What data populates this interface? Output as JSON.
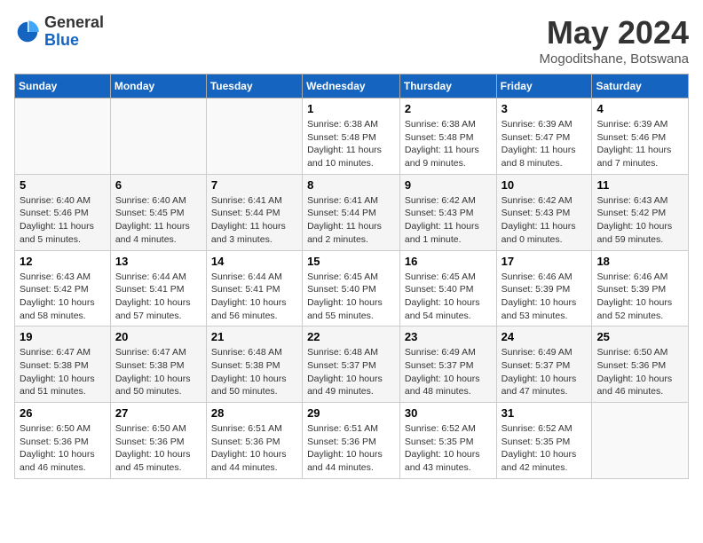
{
  "header": {
    "logo_general": "General",
    "logo_blue": "Blue",
    "month_title": "May 2024",
    "location": "Mogoditshane, Botswana"
  },
  "days_of_week": [
    "Sunday",
    "Monday",
    "Tuesday",
    "Wednesday",
    "Thursday",
    "Friday",
    "Saturday"
  ],
  "weeks": [
    [
      {
        "day": "",
        "info": ""
      },
      {
        "day": "",
        "info": ""
      },
      {
        "day": "",
        "info": ""
      },
      {
        "day": "1",
        "info": "Sunrise: 6:38 AM\nSunset: 5:48 PM\nDaylight: 11 hours and 10 minutes."
      },
      {
        "day": "2",
        "info": "Sunrise: 6:38 AM\nSunset: 5:48 PM\nDaylight: 11 hours and 9 minutes."
      },
      {
        "day": "3",
        "info": "Sunrise: 6:39 AM\nSunset: 5:47 PM\nDaylight: 11 hours and 8 minutes."
      },
      {
        "day": "4",
        "info": "Sunrise: 6:39 AM\nSunset: 5:46 PM\nDaylight: 11 hours and 7 minutes."
      }
    ],
    [
      {
        "day": "5",
        "info": "Sunrise: 6:40 AM\nSunset: 5:46 PM\nDaylight: 11 hours and 5 minutes."
      },
      {
        "day": "6",
        "info": "Sunrise: 6:40 AM\nSunset: 5:45 PM\nDaylight: 11 hours and 4 minutes."
      },
      {
        "day": "7",
        "info": "Sunrise: 6:41 AM\nSunset: 5:44 PM\nDaylight: 11 hours and 3 minutes."
      },
      {
        "day": "8",
        "info": "Sunrise: 6:41 AM\nSunset: 5:44 PM\nDaylight: 11 hours and 2 minutes."
      },
      {
        "day": "9",
        "info": "Sunrise: 6:42 AM\nSunset: 5:43 PM\nDaylight: 11 hours and 1 minute."
      },
      {
        "day": "10",
        "info": "Sunrise: 6:42 AM\nSunset: 5:43 PM\nDaylight: 11 hours and 0 minutes."
      },
      {
        "day": "11",
        "info": "Sunrise: 6:43 AM\nSunset: 5:42 PM\nDaylight: 10 hours and 59 minutes."
      }
    ],
    [
      {
        "day": "12",
        "info": "Sunrise: 6:43 AM\nSunset: 5:42 PM\nDaylight: 10 hours and 58 minutes."
      },
      {
        "day": "13",
        "info": "Sunrise: 6:44 AM\nSunset: 5:41 PM\nDaylight: 10 hours and 57 minutes."
      },
      {
        "day": "14",
        "info": "Sunrise: 6:44 AM\nSunset: 5:41 PM\nDaylight: 10 hours and 56 minutes."
      },
      {
        "day": "15",
        "info": "Sunrise: 6:45 AM\nSunset: 5:40 PM\nDaylight: 10 hours and 55 minutes."
      },
      {
        "day": "16",
        "info": "Sunrise: 6:45 AM\nSunset: 5:40 PM\nDaylight: 10 hours and 54 minutes."
      },
      {
        "day": "17",
        "info": "Sunrise: 6:46 AM\nSunset: 5:39 PM\nDaylight: 10 hours and 53 minutes."
      },
      {
        "day": "18",
        "info": "Sunrise: 6:46 AM\nSunset: 5:39 PM\nDaylight: 10 hours and 52 minutes."
      }
    ],
    [
      {
        "day": "19",
        "info": "Sunrise: 6:47 AM\nSunset: 5:38 PM\nDaylight: 10 hours and 51 minutes."
      },
      {
        "day": "20",
        "info": "Sunrise: 6:47 AM\nSunset: 5:38 PM\nDaylight: 10 hours and 50 minutes."
      },
      {
        "day": "21",
        "info": "Sunrise: 6:48 AM\nSunset: 5:38 PM\nDaylight: 10 hours and 50 minutes."
      },
      {
        "day": "22",
        "info": "Sunrise: 6:48 AM\nSunset: 5:37 PM\nDaylight: 10 hours and 49 minutes."
      },
      {
        "day": "23",
        "info": "Sunrise: 6:49 AM\nSunset: 5:37 PM\nDaylight: 10 hours and 48 minutes."
      },
      {
        "day": "24",
        "info": "Sunrise: 6:49 AM\nSunset: 5:37 PM\nDaylight: 10 hours and 47 minutes."
      },
      {
        "day": "25",
        "info": "Sunrise: 6:50 AM\nSunset: 5:36 PM\nDaylight: 10 hours and 46 minutes."
      }
    ],
    [
      {
        "day": "26",
        "info": "Sunrise: 6:50 AM\nSunset: 5:36 PM\nDaylight: 10 hours and 46 minutes."
      },
      {
        "day": "27",
        "info": "Sunrise: 6:50 AM\nSunset: 5:36 PM\nDaylight: 10 hours and 45 minutes."
      },
      {
        "day": "28",
        "info": "Sunrise: 6:51 AM\nSunset: 5:36 PM\nDaylight: 10 hours and 44 minutes."
      },
      {
        "day": "29",
        "info": "Sunrise: 6:51 AM\nSunset: 5:36 PM\nDaylight: 10 hours and 44 minutes."
      },
      {
        "day": "30",
        "info": "Sunrise: 6:52 AM\nSunset: 5:35 PM\nDaylight: 10 hours and 43 minutes."
      },
      {
        "day": "31",
        "info": "Sunrise: 6:52 AM\nSunset: 5:35 PM\nDaylight: 10 hours and 42 minutes."
      },
      {
        "day": "",
        "info": ""
      }
    ]
  ]
}
